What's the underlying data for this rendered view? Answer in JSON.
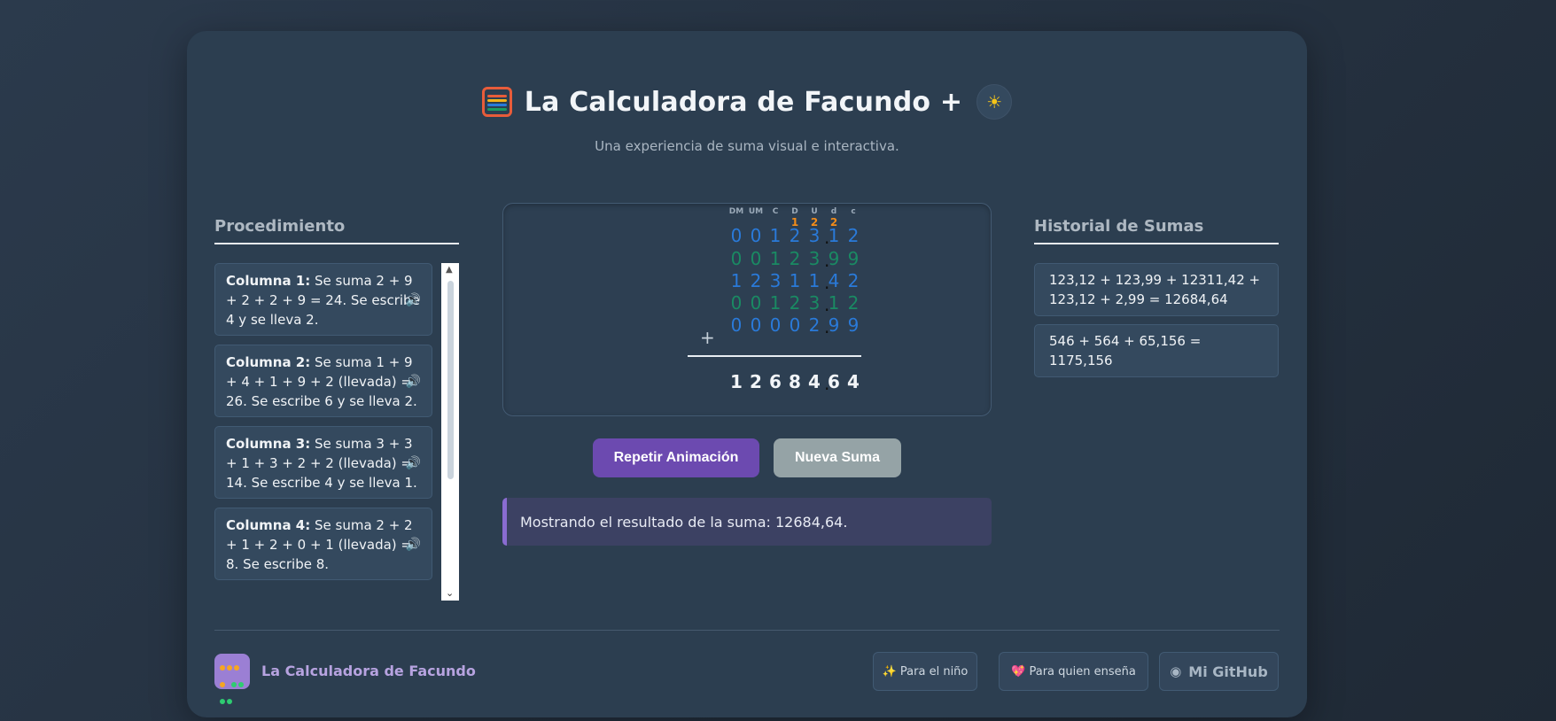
{
  "header": {
    "title": "La Calculadora de Facundo +",
    "subtitle": "Una experiencia de suma visual e interactiva.",
    "theme_icon": "sun-icon"
  },
  "procedure": {
    "title": "Procedimiento",
    "items": [
      {
        "label": "Columna 1:",
        "text": " Se suma 2 + 9 + 2 + 2 + 9 = 24. Se escribe 4 y se lleva 2."
      },
      {
        "label": "Columna 2:",
        "text": " Se suma 1 + 9 + 4 + 1 + 9 + 2 (llevada) = 26. Se escribe 6 y se lleva 2."
      },
      {
        "label": "Columna 3:",
        "text": " Se suma 3 + 3 + 1 + 3 + 2 + 2 (llevada) = 14. Se escribe 4 y se lleva 1."
      },
      {
        "label": "Columna 4:",
        "text": " Se suma 2 + 2 + 1 + 2 + 0 + 1 (llevada) = 8. Se escribe 8."
      }
    ]
  },
  "sum": {
    "col_labels": [
      "DM",
      "UM",
      "C",
      "D",
      "U",
      "d",
      "c"
    ],
    "carries": [
      "",
      "",
      "",
      "1",
      "2",
      "2",
      ""
    ],
    "rows": [
      {
        "digits": [
          "0",
          "0",
          "1",
          "2",
          "3",
          "1",
          "2"
        ],
        "color": "blue"
      },
      {
        "digits": [
          "0",
          "0",
          "1",
          "2",
          "3",
          "9",
          "9"
        ],
        "color": "green"
      },
      {
        "digits": [
          "1",
          "2",
          "3",
          "1",
          "1",
          "4",
          "2"
        ],
        "color": "blue"
      },
      {
        "digits": [
          "0",
          "0",
          "1",
          "2",
          "3",
          "1",
          "2"
        ],
        "color": "green"
      },
      {
        "digits": [
          "0",
          "0",
          "0",
          "0",
          "2",
          "9",
          "9"
        ],
        "color": "blue"
      }
    ],
    "operator": "+",
    "result": [
      "1",
      "2",
      "6",
      "8",
      "4",
      "6",
      "4"
    ]
  },
  "buttons": {
    "repeat": "Repetir Animación",
    "new": "Nueva Suma"
  },
  "status": "Mostrando el resultado de la suma: 12684,64.",
  "history": {
    "title": "Historial de Sumas",
    "items": [
      "123,12 + 123,99 + 12311,42 + 123,12 + 2,99 = 12684,64",
      "546 + 564 + 65,156 = 1175,156"
    ]
  },
  "footer": {
    "brand": "La Calculadora de Facundo",
    "links": {
      "nino": "✨ Para el niño",
      "ensena": "💖 Para quien enseña",
      "github": "Mi GitHub"
    }
  },
  "colors": {
    "accent_purple": "#6c4ab0",
    "digit_blue": "#2a7ad9",
    "digit_green": "#1a8a63",
    "carry_orange": "#f28c1a"
  }
}
